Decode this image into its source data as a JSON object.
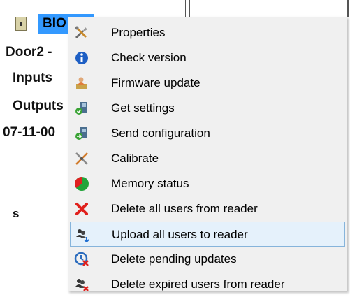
{
  "tree": {
    "root_label": "BIO",
    "nodes": [
      "Door2 -",
      "Inputs",
      "Outputs",
      "07-11-00",
      "s"
    ]
  },
  "menu": {
    "items": [
      {
        "label": "Properties",
        "icon": "tools-icon"
      },
      {
        "label": "Check version",
        "icon": "info-icon"
      },
      {
        "label": "Firmware update",
        "icon": "firmware-update-icon"
      },
      {
        "label": "Get settings",
        "icon": "get-settings-icon"
      },
      {
        "label": "Send configuration",
        "icon": "send-configuration-icon"
      },
      {
        "label": "Calibrate",
        "icon": "calibrate-icon"
      },
      {
        "label": "Memory status",
        "icon": "memory-pie-icon"
      },
      {
        "label": "Delete all users from reader",
        "icon": "red-x-icon"
      },
      {
        "label": "Upload all users to reader",
        "icon": "users-upload-icon"
      },
      {
        "label": "Delete pending updates",
        "icon": "delete-pending-icon"
      },
      {
        "label": "Delete expired users from reader",
        "icon": "delete-expired-users-icon"
      }
    ],
    "highlighted_index": 8
  },
  "colors": {
    "selection": "#3399ff",
    "menu_bg": "#f0f0f0",
    "hover_bg": "#e5f1fb",
    "hover_border": "#86b4db"
  }
}
